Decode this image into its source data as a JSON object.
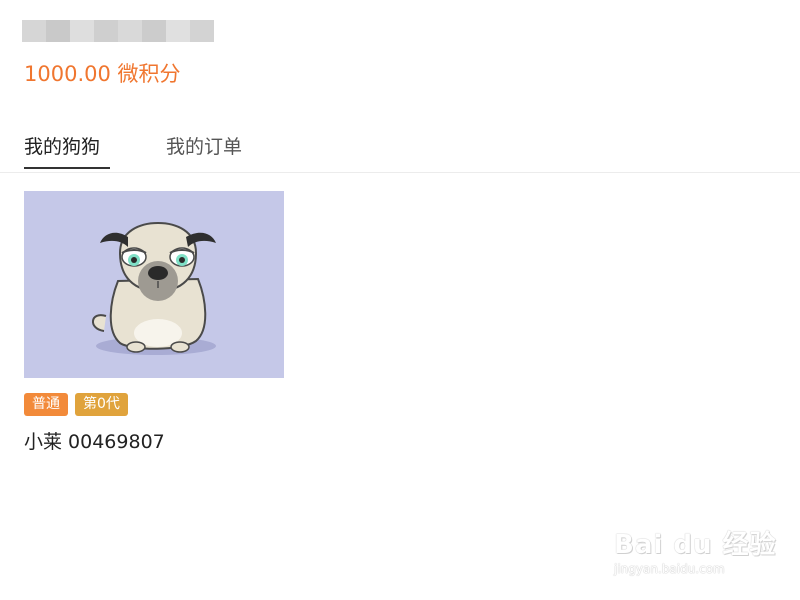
{
  "header": {
    "points": "1000.00 微积分"
  },
  "tabs": [
    {
      "label": "我的狗狗",
      "active": true
    },
    {
      "label": "我的订单",
      "active": false
    }
  ],
  "dogs": [
    {
      "badges": [
        "普通",
        "第0代"
      ],
      "name": "小莱 00469807",
      "image_background": "#c5c8e8"
    }
  ],
  "colors": {
    "accent": "#f0762f",
    "badge_rarity": "#f28a3a",
    "badge_generation": "#e0a33c"
  },
  "watermark": {
    "logo": "Bai du 经验",
    "site": "jingyan.baidu.com"
  }
}
